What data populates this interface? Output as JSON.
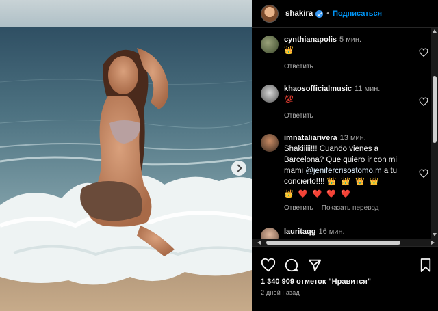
{
  "post": {
    "username": "shakira",
    "follow_label": "Подписаться",
    "likes_text": "1 340 909 отметок \"Нравится\"",
    "date_text": "2 дней назад"
  },
  "comments": [
    {
      "user": "cynthianapolis",
      "time": "5 мин.",
      "emoji": "👑",
      "actions": [
        "Ответить"
      ]
    },
    {
      "user": "khaosofficialmusic",
      "time": "11 мин.",
      "emoji": "💯",
      "actions": [
        "Ответить"
      ]
    },
    {
      "user": "imnataliarivera",
      "time": "13 мин.",
      "text_before": "Shakiiiii!!! Cuando vienes a Barcelona? Que quiero ir con mi mami ",
      "mention": "@jenifercrisostomo.m",
      "text_after": " a tu concierto!!!! ",
      "crowns": "👑 👑 👑 👑",
      "line2": "👑 ❤️ ❤️ ❤️ ❤️",
      "actions": [
        "Ответить",
        "Показать перевод"
      ]
    },
    {
      "user": "lauritaqg",
      "time": "16 мин."
    }
  ],
  "icons": {
    "like": "heart-icon",
    "comment": "comment-icon",
    "share": "send-icon",
    "save": "bookmark-icon",
    "verified": "verified-badge-icon",
    "carousel": "chevron-right-icon"
  },
  "colors": {
    "background": "#000000",
    "link_blue": "#0095f6",
    "verified_blue": "#3897f0",
    "muted_text": "#a8a8a8"
  }
}
